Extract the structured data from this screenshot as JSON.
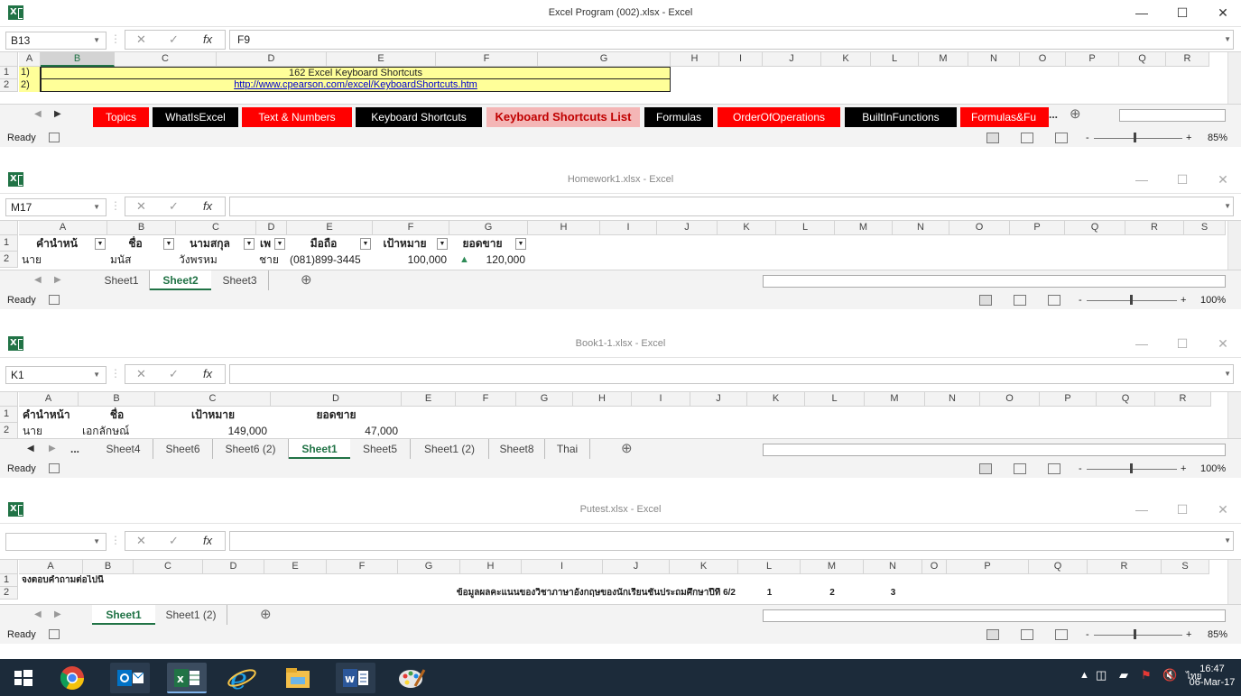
{
  "windows": [
    {
      "title": "Excel Program (002).xlsx - Excel",
      "namebox": "B13",
      "formula": "F9",
      "columns": [
        "A",
        "B",
        "C",
        "D",
        "E",
        "F",
        "G",
        "H",
        "I",
        "J",
        "K",
        "L",
        "M",
        "N",
        "O",
        "P",
        "Q",
        "R"
      ],
      "rows": [
        {
          "num": "1",
          "a": "1)",
          "text": "162 Excel Keyboard Shortcuts"
        },
        {
          "num": "2",
          "a": "2)",
          "text": "http://www.cpearson.com/excel/KeyboardShortcuts.htm"
        }
      ],
      "tabs": [
        "Topics",
        "WhatIsExcel",
        "Text & Numbers",
        "Keyboard Shortcuts",
        "Keyboard Shortcuts List",
        "Formulas",
        "OrderOfOperations",
        "BuiltInFunctions",
        "Formulas&Fu"
      ],
      "tab_more": "...",
      "active_tab": "Keyboard Shortcuts List",
      "status": "Ready",
      "zoom": "85%",
      "zoom_minus": "-",
      "zoom_plus": "+"
    },
    {
      "title": "Homework1.xlsx - Excel",
      "namebox": "M17",
      "formula": "",
      "columns": [
        "A",
        "B",
        "C",
        "D",
        "E",
        "F",
        "G",
        "H",
        "I",
        "J",
        "K",
        "L",
        "M",
        "N",
        "O",
        "P",
        "Q",
        "R",
        "S"
      ],
      "header_row": [
        "คำนำหน้",
        "ชื่อ",
        "นามสกุล",
        "เพ",
        "มือถือ",
        "เป้าหมาย",
        "ยอดขาย"
      ],
      "data_row": [
        "นาย",
        "มนัส",
        "วังพรหม",
        "ชาย",
        "(081)899-3445",
        "100,000",
        "120,000"
      ],
      "tabs": [
        "Sheet1",
        "Sheet2",
        "Sheet3"
      ],
      "active_tab": "Sheet2",
      "status": "Ready",
      "zoom": "100%",
      "zoom_minus": "-",
      "zoom_plus": "+"
    },
    {
      "title": "Book1-1.xlsx - Excel",
      "namebox": "K1",
      "formula": "",
      "columns": [
        "A",
        "B",
        "C",
        "D",
        "E",
        "F",
        "G",
        "H",
        "I",
        "J",
        "K",
        "L",
        "M",
        "N",
        "O",
        "P",
        "Q",
        "R"
      ],
      "header_row": [
        "คำนำหน้า",
        "ชื่อ",
        "เป้าหมาย",
        "ยอดขาย"
      ],
      "data_row": [
        "นาย",
        "เอกลักษณ์",
        "149,000",
        "47,000"
      ],
      "tab_more": "...",
      "tabs": [
        "Sheet4",
        "Sheet6",
        "Sheet6 (2)",
        "Sheet1",
        "Sheet5",
        "Sheet1 (2)",
        "Sheet8",
        "Thai"
      ],
      "active_tab": "Sheet1",
      "status": "Ready",
      "zoom": "100%",
      "zoom_minus": "-",
      "zoom_plus": "+"
    },
    {
      "title": "Putest.xlsx - Excel",
      "namebox": "",
      "formula": "",
      "columns": [
        "A",
        "B",
        "C",
        "D",
        "E",
        "F",
        "G",
        "H",
        "I",
        "J",
        "K",
        "L",
        "M",
        "N",
        "O",
        "P",
        "Q",
        "R",
        "S"
      ],
      "row1": "จงตอบคำถามต่อไปนี้",
      "row2": "ข้อมูลผลคะแนนของวิชาภาษาอังกฤษของนักเรียนชั้นประถมศึกษาปีที่ 6/2",
      "row2_nums": [
        "1",
        "2",
        "3"
      ],
      "tabs": [
        "Sheet1",
        "Sheet1 (2)"
      ],
      "active_tab": "Sheet1",
      "status": "Ready",
      "zoom": "85%",
      "zoom_minus": "-",
      "zoom_plus": "+"
    }
  ],
  "formula_fx": "fx",
  "taskbar": {
    "lang": "ไทย",
    "time": "16:47",
    "date": "06-Mar-17"
  },
  "colors": {
    "excel_green": "#217346",
    "tab_red": "#ff0000",
    "tab_black": "#000000",
    "tab_pink": "#f4b6b6",
    "cell_yellow": "#ffff99",
    "taskbar": "#1c2b3a"
  }
}
